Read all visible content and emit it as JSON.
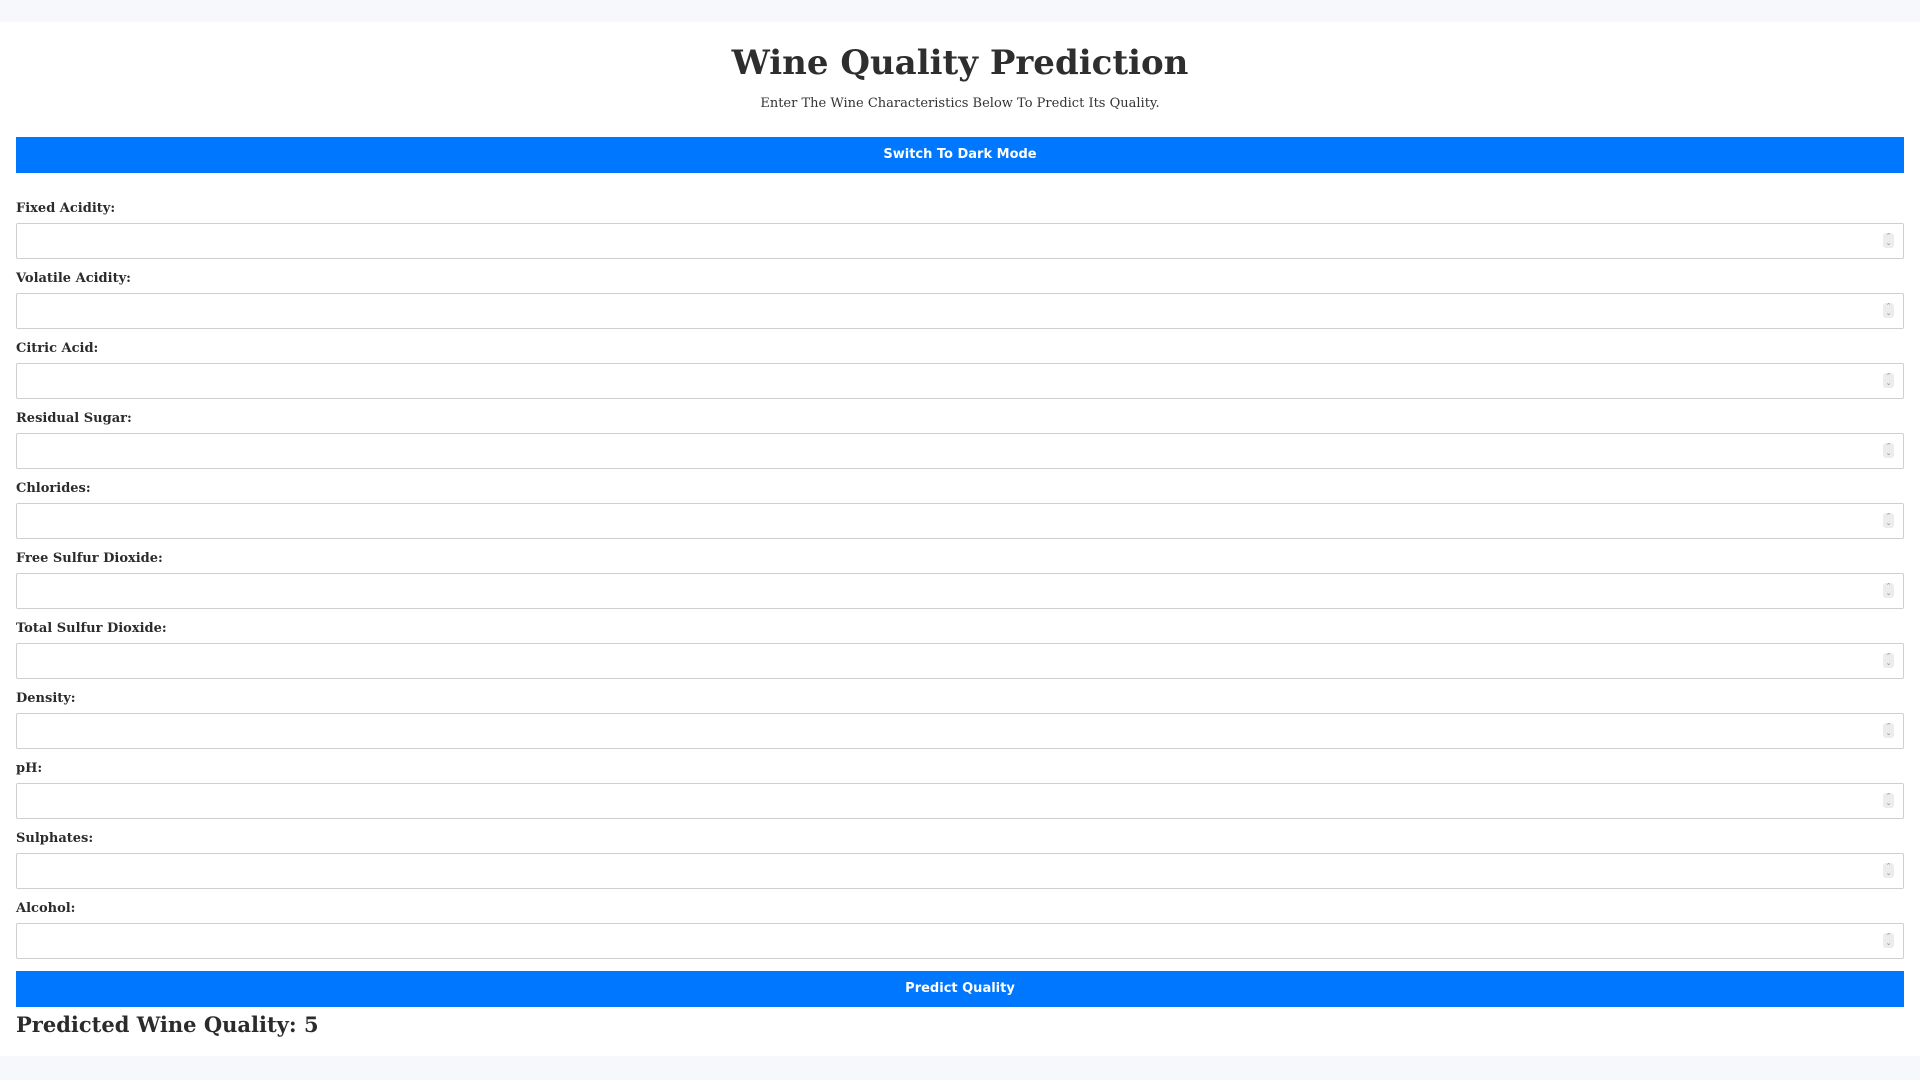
{
  "header": {
    "title": "Wine Quality Prediction",
    "subtitle": "Enter The Wine Characteristics Below To Predict Its Quality."
  },
  "theme_toggle": {
    "label": "Switch To Dark Mode"
  },
  "form": {
    "fields": [
      {
        "label": "Fixed Acidity:",
        "value": ""
      },
      {
        "label": "Volatile Acidity:",
        "value": ""
      },
      {
        "label": "Citric Acid:",
        "value": ""
      },
      {
        "label": "Residual Sugar:",
        "value": ""
      },
      {
        "label": "Chlorides:",
        "value": ""
      },
      {
        "label": "Free Sulfur Dioxide:",
        "value": ""
      },
      {
        "label": "Total Sulfur Dioxide:",
        "value": ""
      },
      {
        "label": "Density:",
        "value": ""
      },
      {
        "label": "pH:",
        "value": ""
      },
      {
        "label": "Sulphates:",
        "value": ""
      },
      {
        "label": "Alcohol:",
        "value": ""
      }
    ],
    "submit_label": "Predict Quality"
  },
  "result": {
    "text": "Predicted Wine Quality: 5"
  },
  "colors": {
    "accent": "#0077ff",
    "page_background": "#f7f8fb",
    "card_background": "#ffffff",
    "text": "#2b2b2b"
  }
}
